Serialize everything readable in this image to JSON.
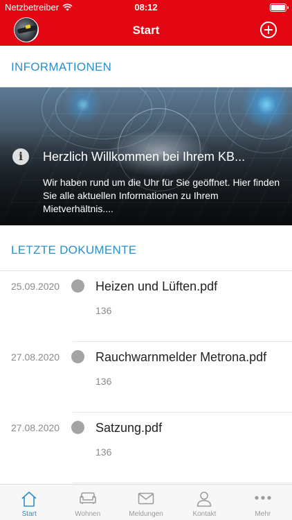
{
  "status_bar": {
    "carrier": "Netzbetreiber",
    "time": "08:12"
  },
  "nav": {
    "title": "Start"
  },
  "sections": {
    "info_title": "INFORMATIONEN",
    "docs_title": "LETZTE DOKUMENTE"
  },
  "banner": {
    "title": "Herzlich Willkommen bei Ihrem KB...",
    "text": "Wir haben rund um die Uhr für Sie geöffnet. Hier finden Sie alle aktuellen Informationen zu Ihrem Mietverhältnis...."
  },
  "documents": [
    {
      "date": "25.09.2020",
      "name": "Heizen und Lüften.pdf",
      "size": "136"
    },
    {
      "date": "27.08.2020",
      "name": "Rauchwarnmelder Metrona.pdf",
      "size": "136"
    },
    {
      "date": "27.08.2020",
      "name": "Satzung.pdf",
      "size": "136"
    }
  ],
  "tabs": [
    {
      "label": "Start",
      "icon": "home-icon",
      "active": true
    },
    {
      "label": "Wohnen",
      "icon": "sofa-icon",
      "active": false
    },
    {
      "label": "Meldungen",
      "icon": "envelope-icon",
      "active": false
    },
    {
      "label": "Kontakt",
      "icon": "person-icon",
      "active": false
    },
    {
      "label": "Mehr",
      "icon": "more-icon",
      "active": false
    }
  ],
  "colors": {
    "brand_red": "#e30613",
    "accent_blue": "#2a8fc9",
    "tab_inactive": "#9a9a9a"
  }
}
